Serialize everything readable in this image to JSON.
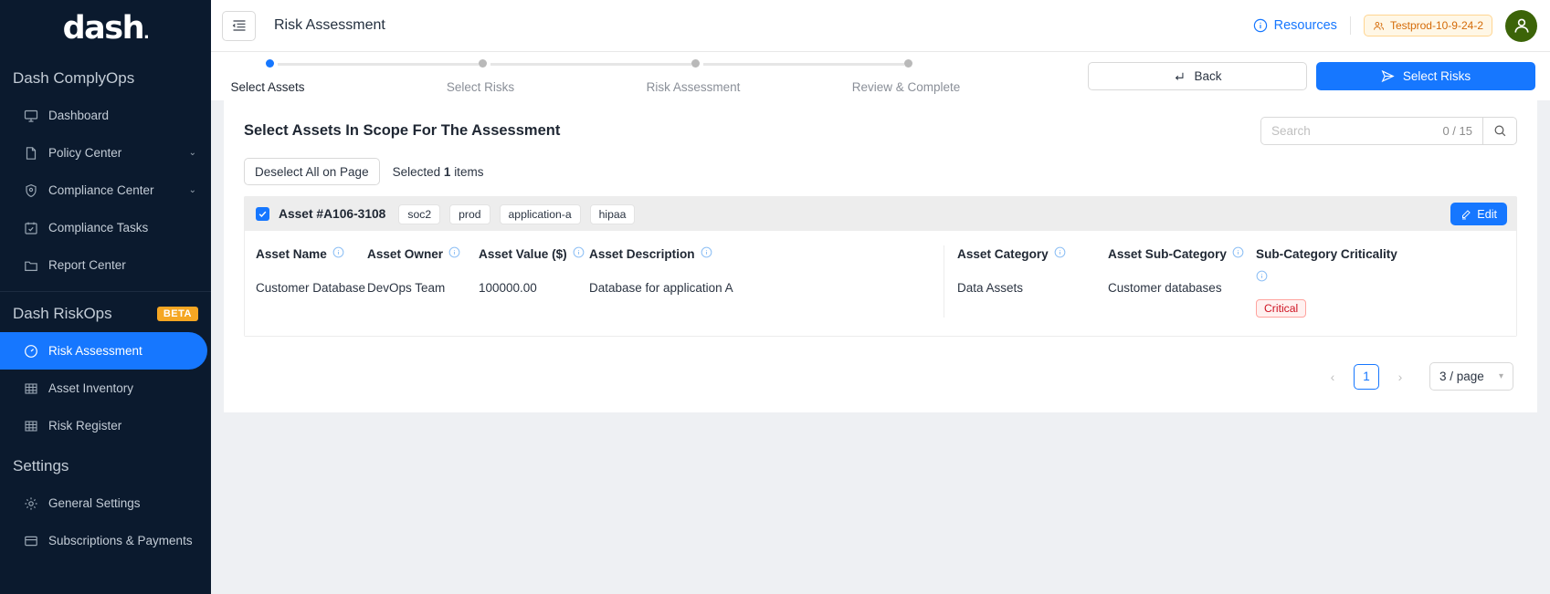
{
  "sidebar": {
    "logo": "dash",
    "groups": [
      {
        "title": "Dash ComplyOps",
        "badge": "",
        "items": [
          {
            "label": "Dashboard",
            "icon": "monitor-icon",
            "chevron": "",
            "active": false
          },
          {
            "label": "Policy Center",
            "icon": "document-icon",
            "chevron": "⌄",
            "active": false
          },
          {
            "label": "Compliance Center",
            "icon": "shield-icon",
            "chevron": "⌄",
            "active": false
          },
          {
            "label": "Compliance Tasks",
            "icon": "calendar-check-icon",
            "chevron": "",
            "active": false
          },
          {
            "label": "Report Center",
            "icon": "folder-icon",
            "chevron": "",
            "active": false
          }
        ]
      },
      {
        "title": "Dash RiskOps",
        "badge": "BETA",
        "items": [
          {
            "label": "Risk Assessment",
            "icon": "gauge-icon",
            "chevron": "",
            "active": true
          },
          {
            "label": "Asset Inventory",
            "icon": "table-icon",
            "chevron": "",
            "active": false
          },
          {
            "label": "Risk Register",
            "icon": "table-icon",
            "chevron": "",
            "active": false
          }
        ]
      },
      {
        "title": "Settings",
        "badge": "",
        "items": [
          {
            "label": "General Settings",
            "icon": "gear-icon",
            "chevron": "",
            "active": false
          },
          {
            "label": "Subscriptions & Payments",
            "icon": "card-icon",
            "chevron": "",
            "active": false
          }
        ]
      }
    ]
  },
  "topbar": {
    "page_title": "Risk Assessment",
    "resources_label": "Resources",
    "tenant_label": "Testprod-10-9-24-2"
  },
  "stepper": {
    "steps": [
      {
        "label": "Select Assets",
        "state": "current"
      },
      {
        "label": "Select Risks",
        "state": "pending"
      },
      {
        "label": "Risk Assessment",
        "state": "pending"
      },
      {
        "label": "Review & Complete",
        "state": "pending"
      }
    ],
    "back_label": "Back",
    "next_label": "Select Risks"
  },
  "card": {
    "title": "Select Assets In Scope For The Assessment",
    "search": {
      "placeholder": "Search",
      "count": "0 / 15"
    },
    "deselect_label": "Deselect All on Page",
    "selected_prefix": "Selected",
    "selected_count": "1",
    "selected_suffix": "items"
  },
  "asset": {
    "id": "Asset #A106-3108",
    "tags": [
      "soc2",
      "prod",
      "application-a",
      "hipaa"
    ],
    "edit_label": "Edit",
    "checked": true,
    "columns_left": [
      {
        "header": "Asset Name",
        "value": "Customer Database"
      },
      {
        "header": "Asset Owner",
        "value": "DevOps Team"
      },
      {
        "header": "Asset Value ($)",
        "value": "100000.00"
      },
      {
        "header": "Asset Description",
        "value": "Database for application A"
      }
    ],
    "columns_right": [
      {
        "header": "Asset Category",
        "value": "Data Assets"
      },
      {
        "header": "Asset Sub-Category",
        "value": "Customer databases"
      }
    ],
    "criticality": {
      "header": "Sub-Category Criticality",
      "value": "Critical"
    }
  },
  "pagination": {
    "prev": "‹",
    "page": "1",
    "next": "›",
    "page_size": "3 / page"
  },
  "colors": {
    "sidebar_bg": "#0b1a2e",
    "accent": "#1677ff",
    "beta": "#f5a623",
    "critical": "#cf1322",
    "tenant": "#d46b08"
  }
}
